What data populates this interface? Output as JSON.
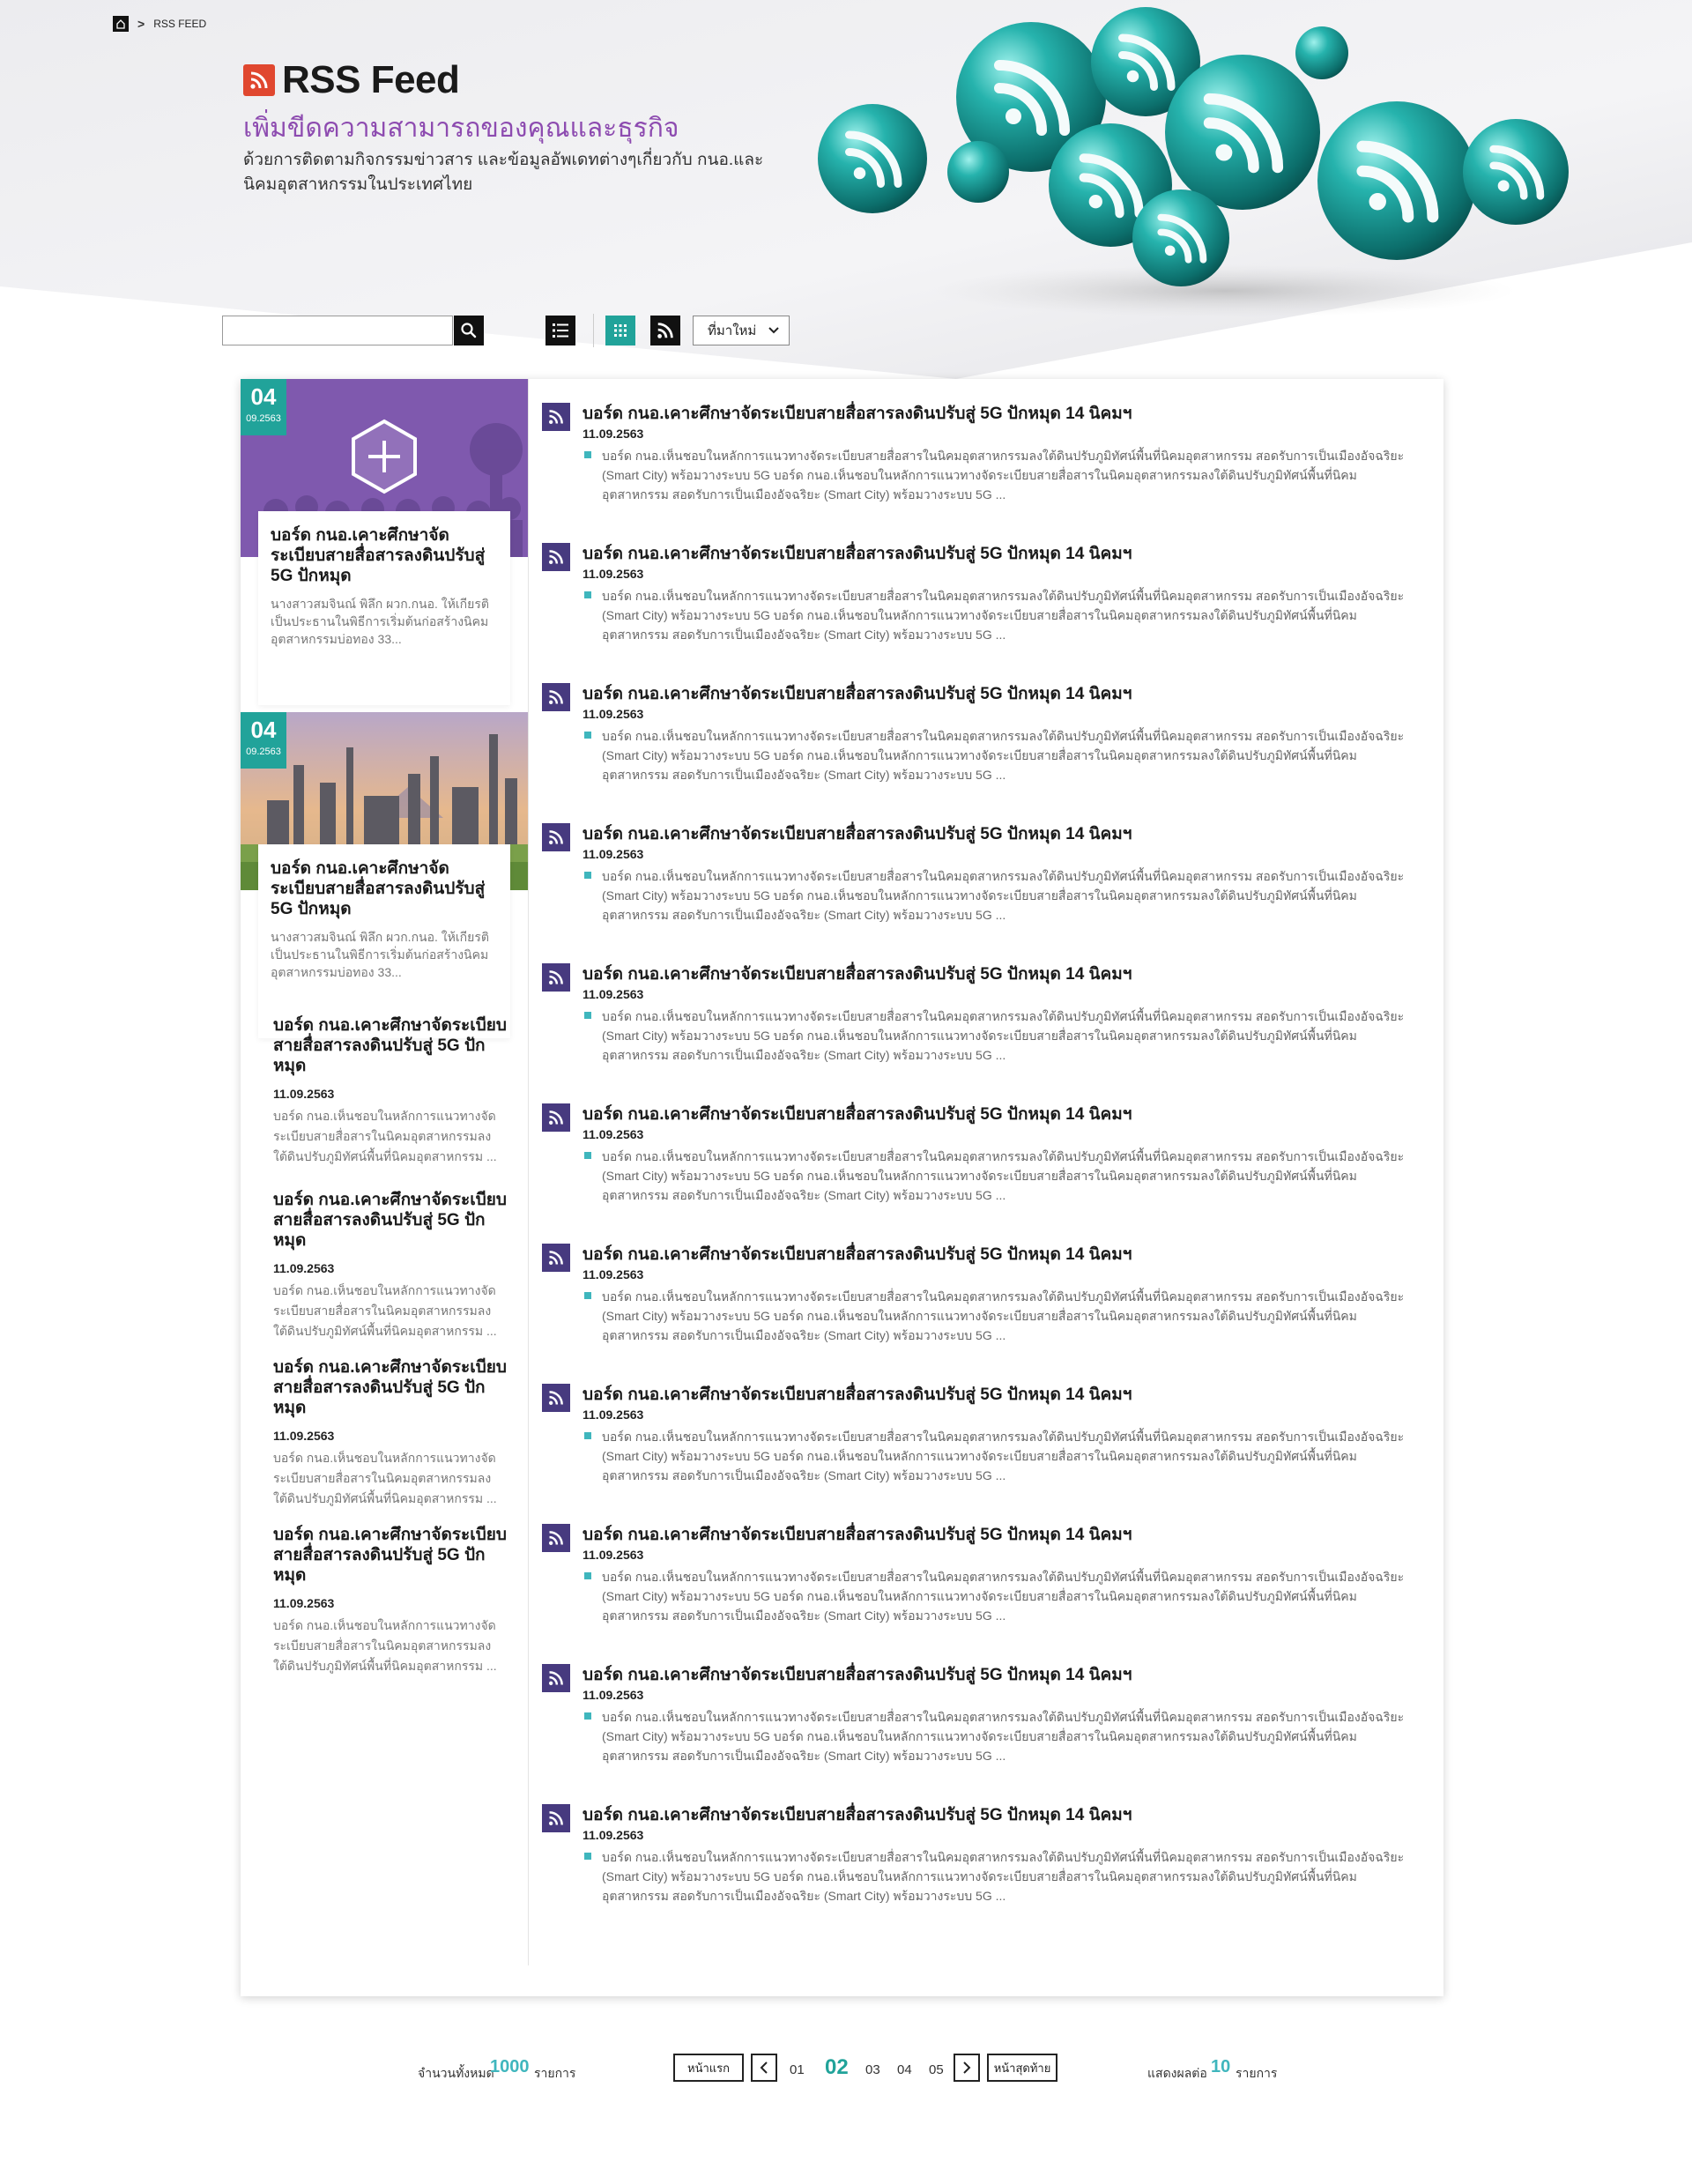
{
  "breadcrumb": {
    "current": "RSS FEED"
  },
  "header": {
    "title": "RSS Feed",
    "subtitle": "เพิ่มขีดความสามารถของคุณและธุรกิจ",
    "description": "ด้วยการติดตามกิจกรรมข่าวสาร และข้อมูลอัพเดทต่างๆเกี่ยวกับ กนอ.และนิคมอุตสาหกรรมในประเทศไทย"
  },
  "toolbar": {
    "search_value": "",
    "sort_selected": "ที่มาใหม่"
  },
  "colors": {
    "accent": "#21a39a",
    "purple": "#8d4bb0",
    "feed_icon": "#473a7f",
    "rss_orange": "#e0472f"
  },
  "featured": [
    {
      "day": "04",
      "month_year": "09.2563",
      "title": "บอร์ด กนอ.เคาะศึกษาจัดระเบียบสายสื่อสารลงดินปรับสู่ 5G ปักหมุด",
      "text": "นางสาวสมจินณ์ พิลึก ผวก.กนอ. ให้เกียรติเป็นประธานในพิธีการเริ่มต้นก่อสร้างนิคมอุตสาหกรรมบ่อทอง 33..."
    },
    {
      "day": "04",
      "month_year": "09.2563",
      "title": "บอร์ด กนอ.เคาะศึกษาจัดระเบียบสายสื่อสารลงดินปรับสู่ 5G ปักหมุด",
      "text": "นางสาวสมจินณ์ พิลึก ผวก.กนอ. ให้เกียรติเป็นประธานในพิธีการเริ่มต้นก่อสร้างนิคมอุตสาหกรรมบ่อทอง 33..."
    }
  ],
  "side_items": [
    {
      "title": "บอร์ด กนอ.เคาะศึกษาจัดระเบียบสายสื่อสารลงดินปรับสู่ 5G ปักหมุด",
      "date": "11.09.2563",
      "text": "บอร์ด กนอ.เห็นชอบในหลักการแนวทางจัดระเบียบสายสื่อสารในนิคมอุตสาหกรรมลงใต้ดินปรับภูมิทัศน์พื้นที่นิคมอุตสาหกรรม ..."
    },
    {
      "title": "บอร์ด กนอ.เคาะศึกษาจัดระเบียบสายสื่อสารลงดินปรับสู่ 5G ปักหมุด",
      "date": "11.09.2563",
      "text": "บอร์ด กนอ.เห็นชอบในหลักการแนวทางจัดระเบียบสายสื่อสารในนิคมอุตสาหกรรมลงใต้ดินปรับภูมิทัศน์พื้นที่นิคมอุตสาหกรรม ..."
    },
    {
      "title": "บอร์ด กนอ.เคาะศึกษาจัดระเบียบสายสื่อสารลงดินปรับสู่ 5G ปักหมุด",
      "date": "11.09.2563",
      "text": "บอร์ด กนอ.เห็นชอบในหลักการแนวทางจัดระเบียบสายสื่อสารในนิคมอุตสาหกรรมลงใต้ดินปรับภูมิทัศน์พื้นที่นิคมอุตสาหกรรม ..."
    },
    {
      "title": "บอร์ด กนอ.เคาะศึกษาจัดระเบียบสายสื่อสารลงดินปรับสู่ 5G ปักหมุด",
      "date": "11.09.2563",
      "text": "บอร์ด กนอ.เห็นชอบในหลักการแนวทางจัดระเบียบสายสื่อสารในนิคมอุตสาหกรรมลงใต้ดินปรับภูมิทัศน์พื้นที่นิคมอุตสาหกรรม ..."
    }
  ],
  "feed": [
    {
      "title": "บอร์ด กนอ.เคาะศึกษาจัดระเบียบสายสื่อสารลงดินปรับสู่ 5G ปักหมุด 14 นิคมฯ",
      "date": "11.09.2563",
      "text": "บอร์ด กนอ.เห็นชอบในหลักการแนวทางจัดระเบียบสายสื่อสารในนิคมอุตสาหกรรมลงใต้ดินปรับภูมิทัศน์พื้นที่นิคมอุตสาหกรรม สอดรับการเป็นเมืองอัจฉริยะ (Smart City) พร้อมวางระบบ 5G บอร์ด กนอ.เห็นชอบในหลักการแนวทางจัดระเบียบสายสื่อสารในนิคมอุตสาหกรรมลงใต้ดินปรับภูมิทัศน์พื้นที่นิคมอุตสาหกรรม สอดรับการเป็นเมืองอัจฉริยะ (Smart City) พร้อมวางระบบ 5G ..."
    },
    {
      "title": "บอร์ด กนอ.เคาะศึกษาจัดระเบียบสายสื่อสารลงดินปรับสู่ 5G ปักหมุด 14 นิคมฯ",
      "date": "11.09.2563",
      "text": "บอร์ด กนอ.เห็นชอบในหลักการแนวทางจัดระเบียบสายสื่อสารในนิคมอุตสาหกรรมลงใต้ดินปรับภูมิทัศน์พื้นที่นิคมอุตสาหกรรม สอดรับการเป็นเมืองอัจฉริยะ (Smart City) พร้อมวางระบบ 5G บอร์ด กนอ.เห็นชอบในหลักการแนวทางจัดระเบียบสายสื่อสารในนิคมอุตสาหกรรมลงใต้ดินปรับภูมิทัศน์พื้นที่นิคมอุตสาหกรรม สอดรับการเป็นเมืองอัจฉริยะ (Smart City) พร้อมวางระบบ 5G ..."
    },
    {
      "title": "บอร์ด กนอ.เคาะศึกษาจัดระเบียบสายสื่อสารลงดินปรับสู่ 5G ปักหมุด 14 นิคมฯ",
      "date": "11.09.2563",
      "text": "บอร์ด กนอ.เห็นชอบในหลักการแนวทางจัดระเบียบสายสื่อสารในนิคมอุตสาหกรรมลงใต้ดินปรับภูมิทัศน์พื้นที่นิคมอุตสาหกรรม สอดรับการเป็นเมืองอัจฉริยะ (Smart City) พร้อมวางระบบ 5G บอร์ด กนอ.เห็นชอบในหลักการแนวทางจัดระเบียบสายสื่อสารในนิคมอุตสาหกรรมลงใต้ดินปรับภูมิทัศน์พื้นที่นิคมอุตสาหกรรม สอดรับการเป็นเมืองอัจฉริยะ (Smart City) พร้อมวางระบบ 5G ..."
    },
    {
      "title": "บอร์ด กนอ.เคาะศึกษาจัดระเบียบสายสื่อสารลงดินปรับสู่ 5G ปักหมุด 14 นิคมฯ",
      "date": "11.09.2563",
      "text": "บอร์ด กนอ.เห็นชอบในหลักการแนวทางจัดระเบียบสายสื่อสารในนิคมอุตสาหกรรมลงใต้ดินปรับภูมิทัศน์พื้นที่นิคมอุตสาหกรรม สอดรับการเป็นเมืองอัจฉริยะ (Smart City) พร้อมวางระบบ 5G บอร์ด กนอ.เห็นชอบในหลักการแนวทางจัดระเบียบสายสื่อสารในนิคมอุตสาหกรรมลงใต้ดินปรับภูมิทัศน์พื้นที่นิคมอุตสาหกรรม สอดรับการเป็นเมืองอัจฉริยะ (Smart City) พร้อมวางระบบ 5G ..."
    },
    {
      "title": "บอร์ด กนอ.เคาะศึกษาจัดระเบียบสายสื่อสารลงดินปรับสู่ 5G ปักหมุด 14 นิคมฯ",
      "date": "11.09.2563",
      "text": "บอร์ด กนอ.เห็นชอบในหลักการแนวทางจัดระเบียบสายสื่อสารในนิคมอุตสาหกรรมลงใต้ดินปรับภูมิทัศน์พื้นที่นิคมอุตสาหกรรม สอดรับการเป็นเมืองอัจฉริยะ (Smart City) พร้อมวางระบบ 5G บอร์ด กนอ.เห็นชอบในหลักการแนวทางจัดระเบียบสายสื่อสารในนิคมอุตสาหกรรมลงใต้ดินปรับภูมิทัศน์พื้นที่นิคมอุตสาหกรรม สอดรับการเป็นเมืองอัจฉริยะ (Smart City) พร้อมวางระบบ 5G ..."
    },
    {
      "title": "บอร์ด กนอ.เคาะศึกษาจัดระเบียบสายสื่อสารลงดินปรับสู่ 5G ปักหมุด 14 นิคมฯ",
      "date": "11.09.2563",
      "text": "บอร์ด กนอ.เห็นชอบในหลักการแนวทางจัดระเบียบสายสื่อสารในนิคมอุตสาหกรรมลงใต้ดินปรับภูมิทัศน์พื้นที่นิคมอุตสาหกรรม สอดรับการเป็นเมืองอัจฉริยะ (Smart City) พร้อมวางระบบ 5G บอร์ด กนอ.เห็นชอบในหลักการแนวทางจัดระเบียบสายสื่อสารในนิคมอุตสาหกรรมลงใต้ดินปรับภูมิทัศน์พื้นที่นิคมอุตสาหกรรม สอดรับการเป็นเมืองอัจฉริยะ (Smart City) พร้อมวางระบบ 5G ..."
    },
    {
      "title": "บอร์ด กนอ.เคาะศึกษาจัดระเบียบสายสื่อสารลงดินปรับสู่ 5G ปักหมุด 14 นิคมฯ",
      "date": "11.09.2563",
      "text": "บอร์ด กนอ.เห็นชอบในหลักการแนวทางจัดระเบียบสายสื่อสารในนิคมอุตสาหกรรมลงใต้ดินปรับภูมิทัศน์พื้นที่นิคมอุตสาหกรรม สอดรับการเป็นเมืองอัจฉริยะ (Smart City) พร้อมวางระบบ 5G บอร์ด กนอ.เห็นชอบในหลักการแนวทางจัดระเบียบสายสื่อสารในนิคมอุตสาหกรรมลงใต้ดินปรับภูมิทัศน์พื้นที่นิคมอุตสาหกรรม สอดรับการเป็นเมืองอัจฉริยะ (Smart City) พร้อมวางระบบ 5G ..."
    },
    {
      "title": "บอร์ด กนอ.เคาะศึกษาจัดระเบียบสายสื่อสารลงดินปรับสู่ 5G ปักหมุด 14 นิคมฯ",
      "date": "11.09.2563",
      "text": "บอร์ด กนอ.เห็นชอบในหลักการแนวทางจัดระเบียบสายสื่อสารในนิคมอุตสาหกรรมลงใต้ดินปรับภูมิทัศน์พื้นที่นิคมอุตสาหกรรม สอดรับการเป็นเมืองอัจฉริยะ (Smart City) พร้อมวางระบบ 5G บอร์ด กนอ.เห็นชอบในหลักการแนวทางจัดระเบียบสายสื่อสารในนิคมอุตสาหกรรมลงใต้ดินปรับภูมิทัศน์พื้นที่นิคมอุตสาหกรรม สอดรับการเป็นเมืองอัจฉริยะ (Smart City) พร้อมวางระบบ 5G ..."
    },
    {
      "title": "บอร์ด กนอ.เคาะศึกษาจัดระเบียบสายสื่อสารลงดินปรับสู่ 5G ปักหมุด 14 นิคมฯ",
      "date": "11.09.2563",
      "text": "บอร์ด กนอ.เห็นชอบในหลักการแนวทางจัดระเบียบสายสื่อสารในนิคมอุตสาหกรรมลงใต้ดินปรับภูมิทัศน์พื้นที่นิคมอุตสาหกรรม สอดรับการเป็นเมืองอัจฉริยะ (Smart City) พร้อมวางระบบ 5G บอร์ด กนอ.เห็นชอบในหลักการแนวทางจัดระเบียบสายสื่อสารในนิคมอุตสาหกรรมลงใต้ดินปรับภูมิทัศน์พื้นที่นิคมอุตสาหกรรม สอดรับการเป็นเมืองอัจฉริยะ (Smart City) พร้อมวางระบบ 5G ..."
    },
    {
      "title": "บอร์ด กนอ.เคาะศึกษาจัดระเบียบสายสื่อสารลงดินปรับสู่ 5G ปักหมุด 14 นิคมฯ",
      "date": "11.09.2563",
      "text": "บอร์ด กนอ.เห็นชอบในหลักการแนวทางจัดระเบียบสายสื่อสารในนิคมอุตสาหกรรมลงใต้ดินปรับภูมิทัศน์พื้นที่นิคมอุตสาหกรรม สอดรับการเป็นเมืองอัจฉริยะ (Smart City) พร้อมวางระบบ 5G บอร์ด กนอ.เห็นชอบในหลักการแนวทางจัดระเบียบสายสื่อสารในนิคมอุตสาหกรรมลงใต้ดินปรับภูมิทัศน์พื้นที่นิคมอุตสาหกรรม สอดรับการเป็นเมืองอัจฉริยะ (Smart City) พร้อมวางระบบ 5G ..."
    },
    {
      "title": "บอร์ด กนอ.เคาะศึกษาจัดระเบียบสายสื่อสารลงดินปรับสู่ 5G ปักหมุด 14 นิคมฯ",
      "date": "11.09.2563",
      "text": "บอร์ด กนอ.เห็นชอบในหลักการแนวทางจัดระเบียบสายสื่อสารในนิคมอุตสาหกรรมลงใต้ดินปรับภูมิทัศน์พื้นที่นิคมอุตสาหกรรม สอดรับการเป็นเมืองอัจฉริยะ (Smart City) พร้อมวางระบบ 5G บอร์ด กนอ.เห็นชอบในหลักการแนวทางจัดระเบียบสายสื่อสารในนิคมอุตสาหกรรมลงใต้ดินปรับภูมิทัศน์พื้นที่นิคมอุตสาหกรรม สอดรับการเป็นเมืองอัจฉริยะ (Smart City) พร้อมวางระบบ 5G ..."
    }
  ],
  "pagination": {
    "total_label": "จำนวนทั้งหมด",
    "total_count": "1000",
    "total_unit": "รายการ",
    "first_label": "หน้าแรก",
    "last_label": "หน้าสุดท้าย",
    "pages": [
      "01",
      "02",
      "03",
      "04",
      "05"
    ],
    "current_page": "02",
    "per_page_label": "แสดงผลต่อ",
    "per_page_count": "10",
    "per_page_unit": "รายการ"
  }
}
